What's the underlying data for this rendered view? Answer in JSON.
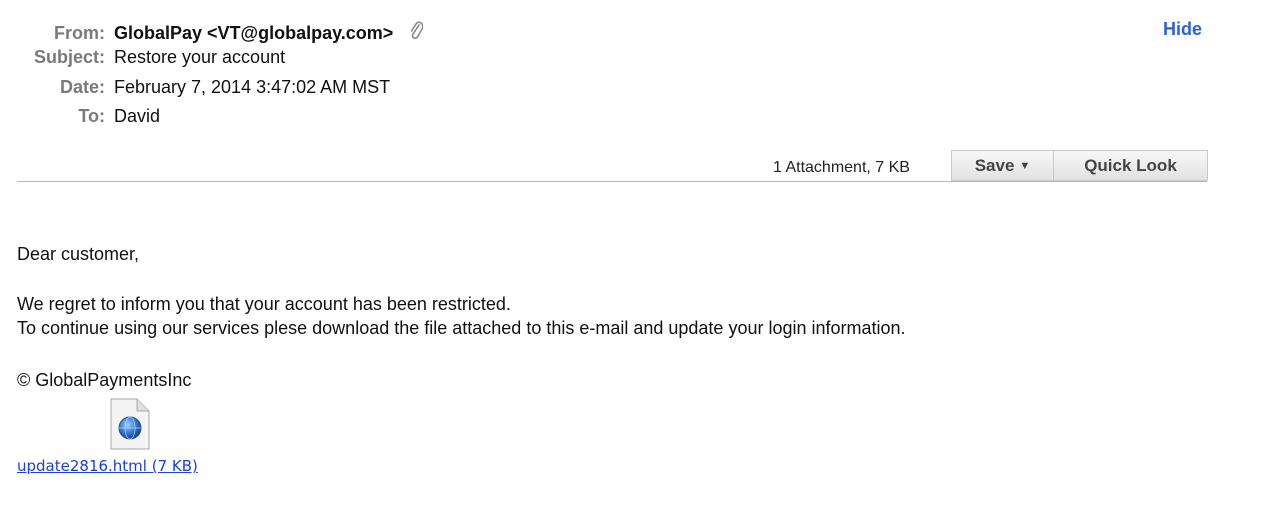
{
  "header": {
    "from_label": "From:",
    "from_value": "GlobalPay <VT@globalpay.com>",
    "subject_label": "Subject:",
    "subject_value": "Restore your account",
    "date_label": "Date:",
    "date_value": "February 7, 2014 3:47:02 AM MST",
    "to_label": "To:",
    "to_value": "David",
    "hide_label": "Hide"
  },
  "attachments_bar": {
    "summary": "1 Attachment, 7 KB",
    "save_label": "Save",
    "quicklook_label": "Quick Look"
  },
  "message": {
    "greeting": "Dear customer,",
    "line1": "We regret to inform you that your account has been restricted.",
    "line2": "To continue using our services plese download the file attached to this e-mail and update your login information.",
    "signature": "© GlobalPaymentsInc"
  },
  "attachment": {
    "link_text": "update2816.html (7 KB)",
    "icon": "html-file-icon"
  },
  "colors": {
    "link": "#2a62d8",
    "label": "#7a7a7a"
  }
}
